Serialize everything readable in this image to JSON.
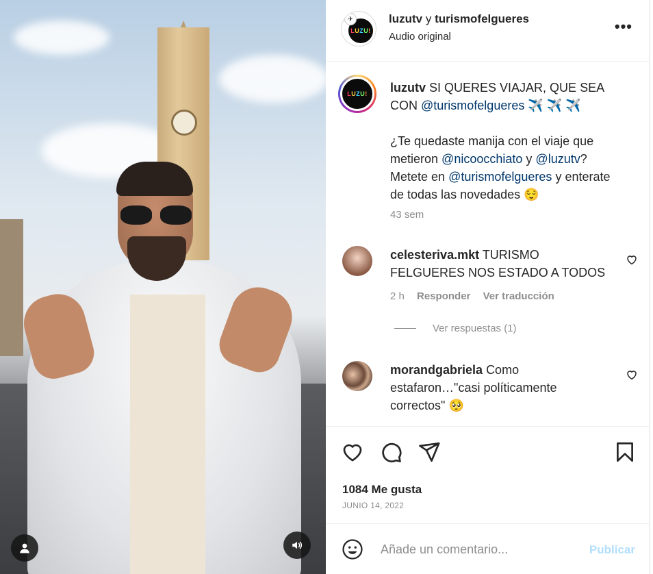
{
  "media": {
    "user_icon": "person-icon",
    "audio_icon": "speaker-icon"
  },
  "header": {
    "account_1": "luzutv",
    "connector": "y",
    "account_2": "turismofelgueres",
    "subtitle": "Audio original",
    "more": "•••"
  },
  "caption": {
    "username": "luzutv",
    "line1": "SI QUERES VIAJAR, QUE SEA CON",
    "mention1": "@turismofelgueres",
    "emoji1": "✈️ ✈️ ✈️",
    "p2_a": "¿Te quedaste manija con el viaje que metieron",
    "mention2": "@nicoocchiato",
    "p2_b": "y",
    "mention3": "@luzutv",
    "p2_c": "?",
    "p3_a": "Metete en",
    "mention4": "@turismofelgueres",
    "p3_b": "y enterate de todas las novedades",
    "emoji2": "😌",
    "time": "43 sem"
  },
  "comments": [
    {
      "username": "celesteriva.mkt",
      "text": "TURISMO FELGUERES NOS ESTADO A TODOS",
      "time": "2 h",
      "reply": "Responder",
      "translate": "Ver traducción",
      "view_replies": "Ver respuestas (1)"
    },
    {
      "username": "morandgabriela",
      "text": "Como estafaron…\"casi políticamente correctos\"",
      "emoji": "🥺"
    }
  ],
  "actions": {
    "likes": "1084 Me gusta",
    "date": "JUNIO 14, 2022"
  },
  "add_comment": {
    "placeholder": "Añade un comentario...",
    "publish": "Publicar"
  },
  "colors": {
    "link": "#00376b",
    "muted": "#8e8e8e",
    "publish_disabled": "#b2dffc"
  }
}
